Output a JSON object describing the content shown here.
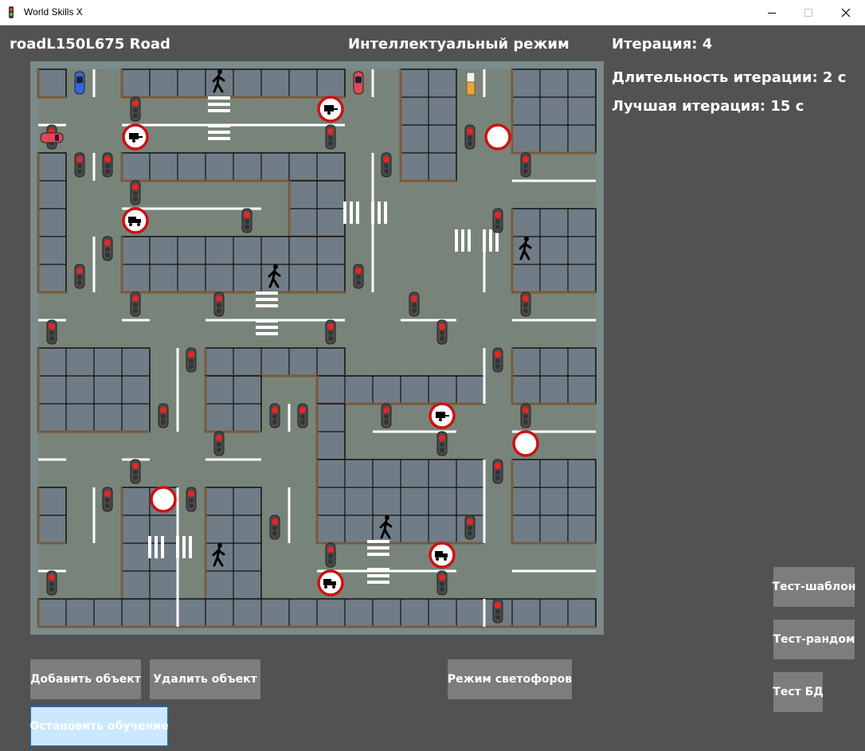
{
  "window": {
    "title": "World Skills X"
  },
  "header": {
    "road_name": "roadL150L675 Road",
    "mode": "Интеллектуальный режим",
    "iteration": "Итерация: 4",
    "duration": "Длительность итерации: 2 с",
    "best": "Лучшая итерация: 15 с"
  },
  "buttons": {
    "add_object": "Добавить объект",
    "delete_object": "Удалить объект",
    "traffic_mode": "Режим светофоров",
    "stop_training": "Остановить обучение",
    "test_template": "Тест-шаблон",
    "test_random": "Тест-рандом",
    "test_db": "Тест БД"
  },
  "colors": {
    "background": "#525252",
    "board_frame": "#7b8a8a",
    "road": "#78847a",
    "block": "#717d86",
    "curb": "#7a5a3a",
    "sign_red": "#cc1111",
    "light_red": "#ee2222",
    "car_blue": "#3a63d8",
    "car_red": "#e04858"
  },
  "icons": {
    "traffic_light": "traffic-light-icon",
    "no_entry": "no-vehicles-sign-icon",
    "no_trucks": "no-trucks-sign-icon",
    "no_trailer": "no-trailer-sign-icon",
    "pedestrian": "pedestrian-icon",
    "car": "car-icon",
    "bus": "bus-icon"
  }
}
